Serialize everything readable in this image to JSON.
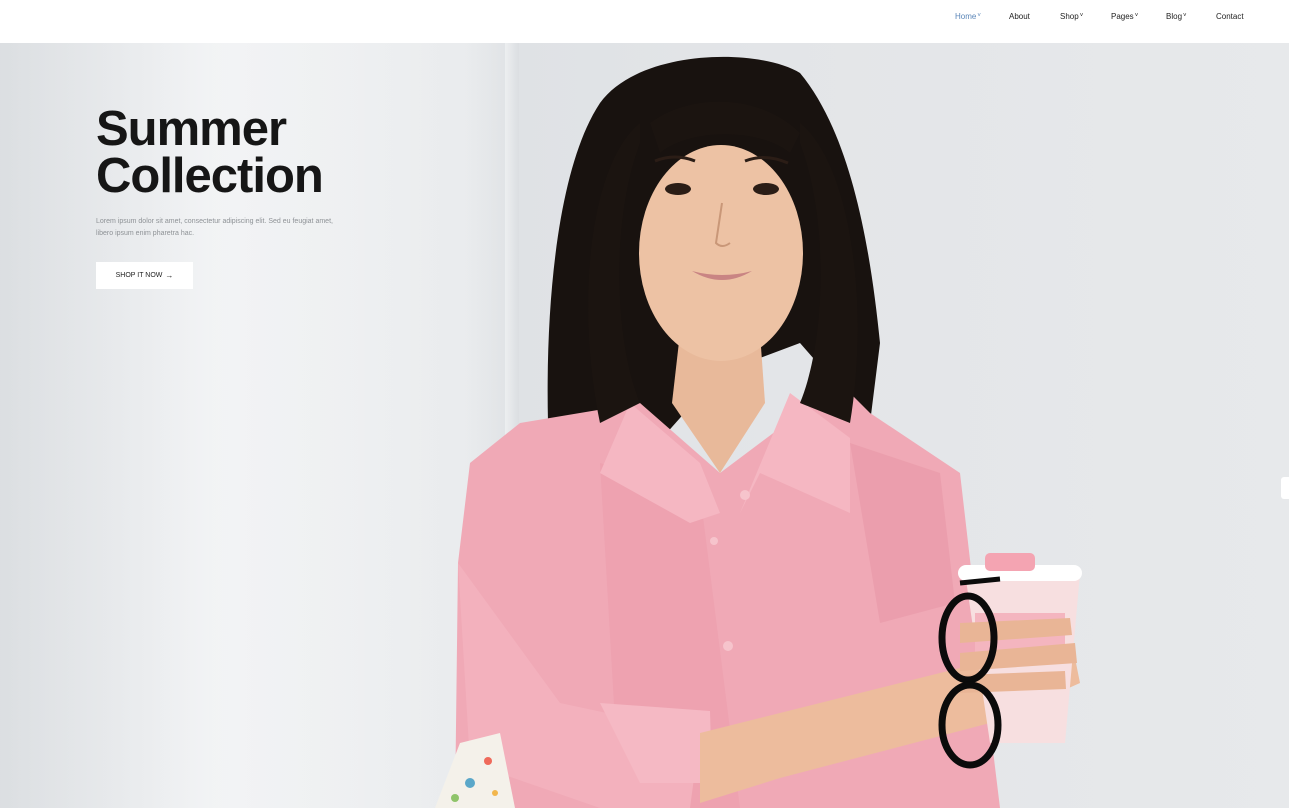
{
  "nav": {
    "items": [
      {
        "label": "Home",
        "dropdown": true,
        "active": true
      },
      {
        "label": "About",
        "dropdown": false,
        "active": false
      },
      {
        "label": "Shop",
        "dropdown": true,
        "active": false
      },
      {
        "label": "Pages",
        "dropdown": true,
        "active": false
      },
      {
        "label": "Blog",
        "dropdown": true,
        "active": false
      },
      {
        "label": "Contact",
        "dropdown": false,
        "active": false
      }
    ],
    "caret": "˅"
  },
  "hero": {
    "title_line1": "Summer",
    "title_line2": "Collection",
    "description": "Lorem ipsum dolor sit amet, consectetur adipiscing elit. Sed eu feugiat amet, libero ipsum enim pharetra hac.",
    "cta_label": "SHOP IT NOW",
    "cta_icon": "arrow-right-icon",
    "cta_arrow": "→",
    "image": "woman-in-pink-shirt-holding-glasses-and-cup"
  },
  "colors": {
    "accent": "#5b86b8",
    "title": "#161616",
    "shirt": "#f0a9b6"
  }
}
